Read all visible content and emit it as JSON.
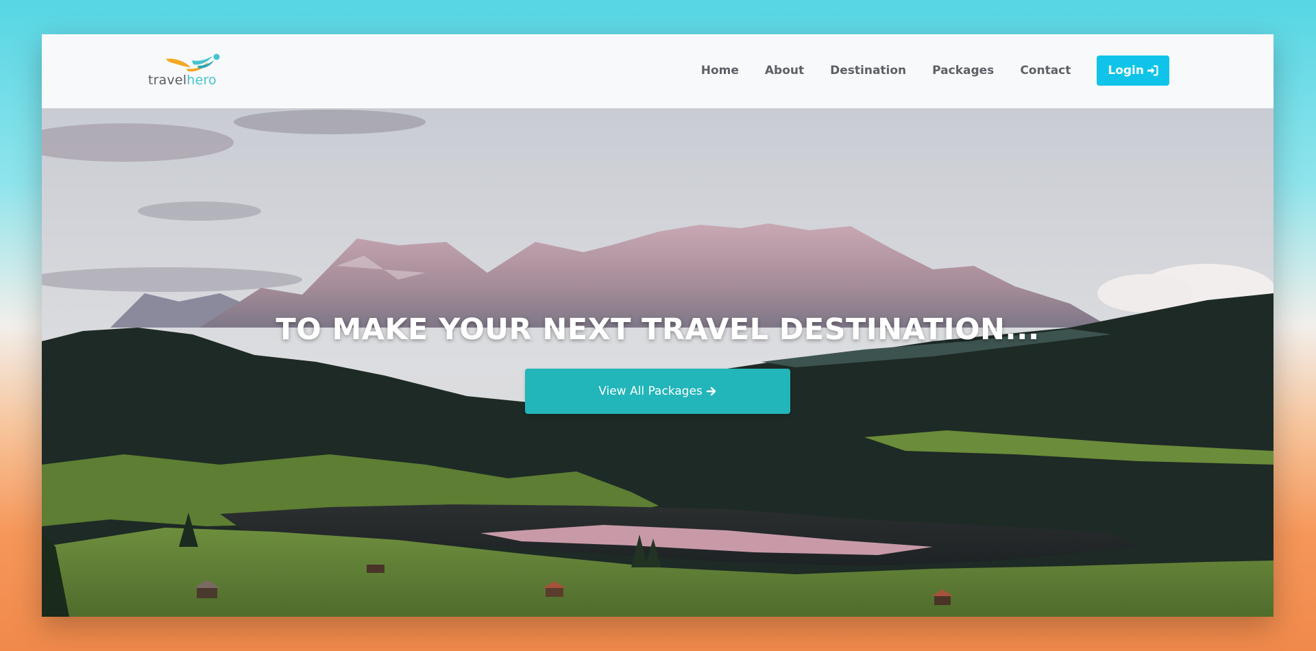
{
  "brand": {
    "name_part1": "travel",
    "name_part2": "hero",
    "colors": {
      "swoosh_orange": "#f5a623",
      "teal": "#46c3cf",
      "text_gray": "#5a5f63"
    }
  },
  "nav": {
    "items": [
      {
        "label": "Home"
      },
      {
        "label": "About"
      },
      {
        "label": "Destination"
      },
      {
        "label": "Packages"
      },
      {
        "label": "Contact"
      }
    ],
    "login_label": "Login",
    "login_icon": "sign-in-icon",
    "login_color": "#0fc4e8"
  },
  "hero": {
    "title": "TO MAKE YOUR NEXT TRAVEL DESTINATION...",
    "cta_label": "View All Packages",
    "cta_icon": "arrow-right-icon",
    "cta_color": "#22b5b9"
  }
}
